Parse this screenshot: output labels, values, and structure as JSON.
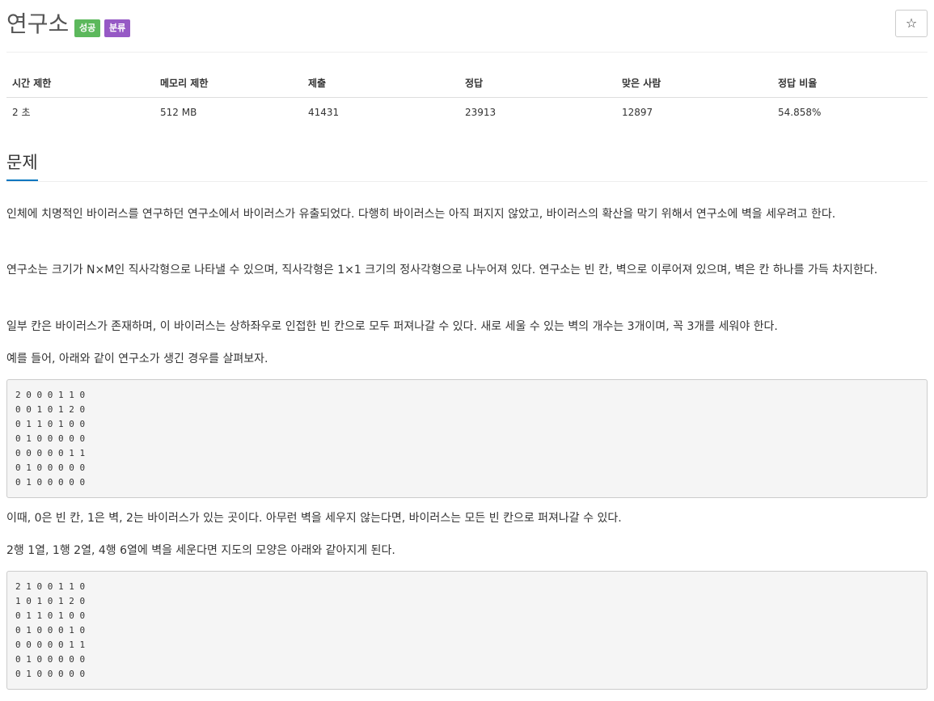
{
  "problem": {
    "title": "연구소",
    "badges": [
      {
        "label": "성공",
        "color": "#5cb85c"
      },
      {
        "label": "분류",
        "color": "#9659c5"
      }
    ],
    "star_icon": "☆"
  },
  "stats": {
    "headers": [
      "시간 제한",
      "메모리 제한",
      "제출",
      "정답",
      "맞은 사람",
      "정답 비율"
    ],
    "values": [
      "2 초",
      "512 MB",
      "41431",
      "23913",
      "12897",
      "54.858%"
    ]
  },
  "section": {
    "title": "문제",
    "accent_color": "#0076c0"
  },
  "paragraphs": [
    "인체에 치명적인 바이러스를 연구하던 연구소에서 바이러스가 유출되었다. 다행히 바이러스는 아직 퍼지지 않았고, 바이러스의 확산을 막기 위해서 연구소에 벽을 세우려고 한다.",
    "연구소는 크기가 N×M인 직사각형으로 나타낼 수 있으며, 직사각형은 1×1 크기의 정사각형으로 나누어져 있다. 연구소는 빈 칸, 벽으로 이루어져 있으며, 벽은 칸 하나를 가득 차지한다.",
    "일부 칸은 바이러스가 존재하며, 이 바이러스는 상하좌우로 인접한 빈 칸으로 모두 퍼져나갈 수 있다. 새로 세울 수 있는 벽의 개수는 3개이며, 꼭 3개를 세워야 한다.",
    "예를 들어, 아래와 같이 연구소가 생긴 경우를 살펴보자.",
    "이때, 0은 빈 칸, 1은 벽, 2는 바이러스가 있는 곳이다. 아무런 벽을 세우지 않는다면, 바이러스는 모든 빈 칸으로 퍼져나갈 수 있다.",
    "2행 1열, 1행 2열, 4행 6열에 벽을 세운다면 지도의 모양은 아래와 같아지게 된다."
  ],
  "code_blocks": [
    [
      "2 0 0 0 1 1 0",
      "0 0 1 0 1 2 0",
      "0 1 1 0 1 0 0",
      "0 1 0 0 0 0 0",
      "0 0 0 0 0 1 1",
      "0 1 0 0 0 0 0",
      "0 1 0 0 0 0 0"
    ],
    [
      "2 1 0 0 1 1 0",
      "1 0 1 0 1 2 0",
      "0 1 1 0 1 0 0",
      "0 1 0 0 0 1 0",
      "0 0 0 0 0 1 1",
      "0 1 0 0 0 0 0",
      "0 1 0 0 0 0 0"
    ]
  ]
}
